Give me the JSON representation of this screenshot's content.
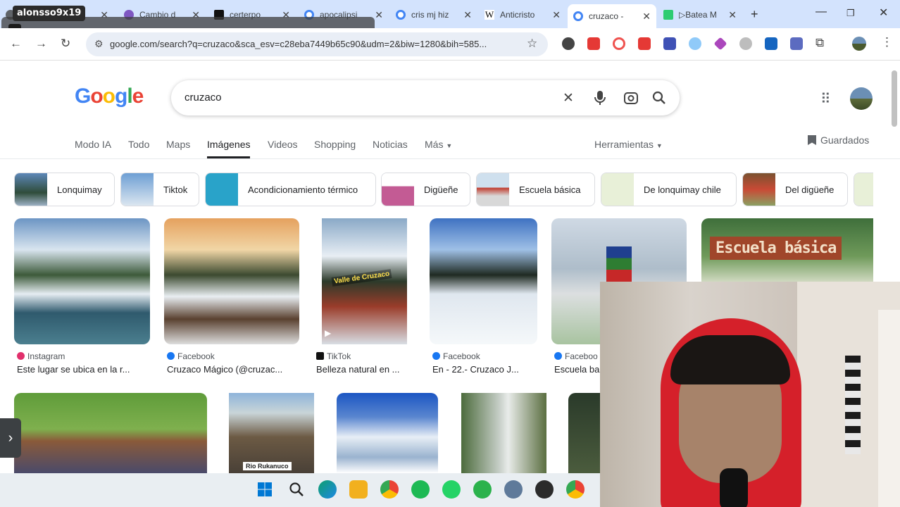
{
  "browser": {
    "tabs": [
      {
        "title": "",
        "color": "#5f6368"
      },
      {
        "title": "Cambio d",
        "color": "#7e57c2"
      },
      {
        "title": "certerpo",
        "color": "#111111"
      },
      {
        "title": "apocalipsi",
        "color": "#4285f4"
      },
      {
        "title": "cris mj hiz",
        "color": "#4285f4"
      },
      {
        "title": "Anticristo",
        "color": "#000000"
      },
      {
        "title": "cruzaco - ",
        "color": "#4285f4"
      },
      {
        "title": "▷Batea M",
        "color": "#2ecc71"
      }
    ],
    "new_tab_label": "+",
    "account_overlay_name": "alonsso9x19",
    "url": "google.com/search?q=cruzaco&sca_esv=c28eba7449b65c90&udm=2&biw=1280&bih=585..."
  },
  "google": {
    "logo": "Google",
    "query": "cruzaco",
    "nav_tabs": [
      "Modo IA",
      "Todo",
      "Maps",
      "Imágenes",
      "Videos",
      "Shopping",
      "Noticias",
      "Más"
    ],
    "active_tab": "Imágenes",
    "tools_label": "Herramientas",
    "saved_label": "Guardados",
    "chips": [
      "Lonquimay",
      "Tiktok",
      "Acondicionamiento térmico",
      "Digüeñe",
      "Escuela básica",
      "De lonquimay chile",
      "Del digüeñe"
    ],
    "results_row1": [
      {
        "source": "Instagram",
        "caption": "Este lugar se ubica en la r...",
        "overlay_text": ""
      },
      {
        "source": "Facebook",
        "caption": "Cruzaco Mágico (@cruzac...",
        "overlay_text": ""
      },
      {
        "source": "TikTok",
        "caption": "Belleza natural en ...",
        "overlay_text": "Valle de Cruzaco"
      },
      {
        "source": "Facebook",
        "caption": "En - 22.- Cruzaco J...",
        "overlay_text": ""
      },
      {
        "source": "Faceboo",
        "caption": "Escuela ba",
        "overlay_text": ""
      },
      {
        "source": "",
        "caption": "",
        "overlay_text": "Escuela básica"
      }
    ],
    "results_row2_overlay": "Rio Rukanuco"
  }
}
